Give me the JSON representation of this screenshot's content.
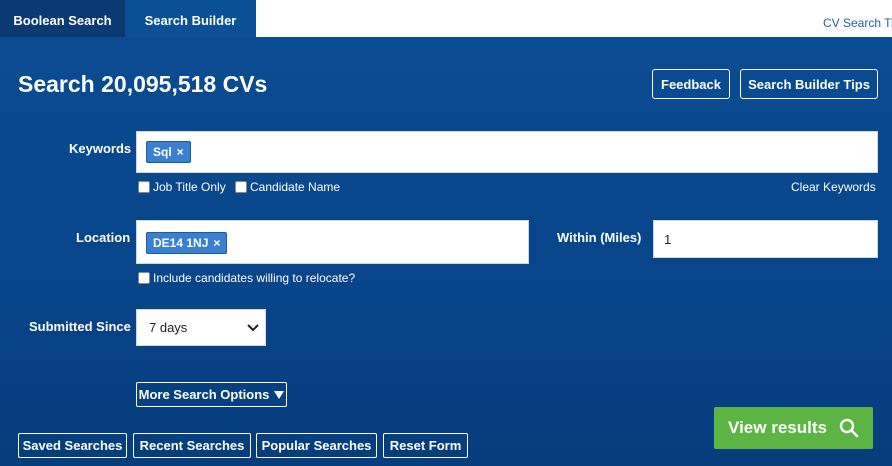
{
  "tabs": [
    {
      "label": "Boolean Search"
    },
    {
      "label": "Search Builder"
    }
  ],
  "tips_link": "CV Search Tip",
  "header": {
    "title": "Search 20,095,518 CVs",
    "feedback_label": "Feedback",
    "builder_tips_label": "Search Builder Tips"
  },
  "keywords": {
    "label": "Keywords",
    "tags": [
      {
        "text": "Sql",
        "remove": "×"
      }
    ],
    "job_title_only": "Job Title Only",
    "candidate_name": "Candidate Name",
    "clear": "Clear Keywords"
  },
  "location": {
    "label": "Location",
    "tags": [
      {
        "text": "DE14 1NJ",
        "remove": "×"
      }
    ],
    "relocate": "Include candidates willing to relocate?",
    "within_label": "Within (Miles)",
    "within_value": "1"
  },
  "submitted": {
    "label": "Submitted Since",
    "selected": "7 days"
  },
  "more_options": {
    "label": "More Search Options",
    "icon": "caret-down-icon"
  },
  "bottom_buttons": {
    "saved": "Saved Searches",
    "recent": "Recent Searches",
    "popular": "Popular Searches",
    "reset": "Reset Form"
  },
  "view_results": {
    "label": "View results",
    "icon": "search-icon"
  },
  "colors": {
    "panel": "#0a4c92",
    "tab_active": "#0b4f95",
    "tab_inactive": "#0b3a72",
    "tag": "#3b80d0",
    "view_button": "#5cb543",
    "link": "#1e5fa8"
  }
}
